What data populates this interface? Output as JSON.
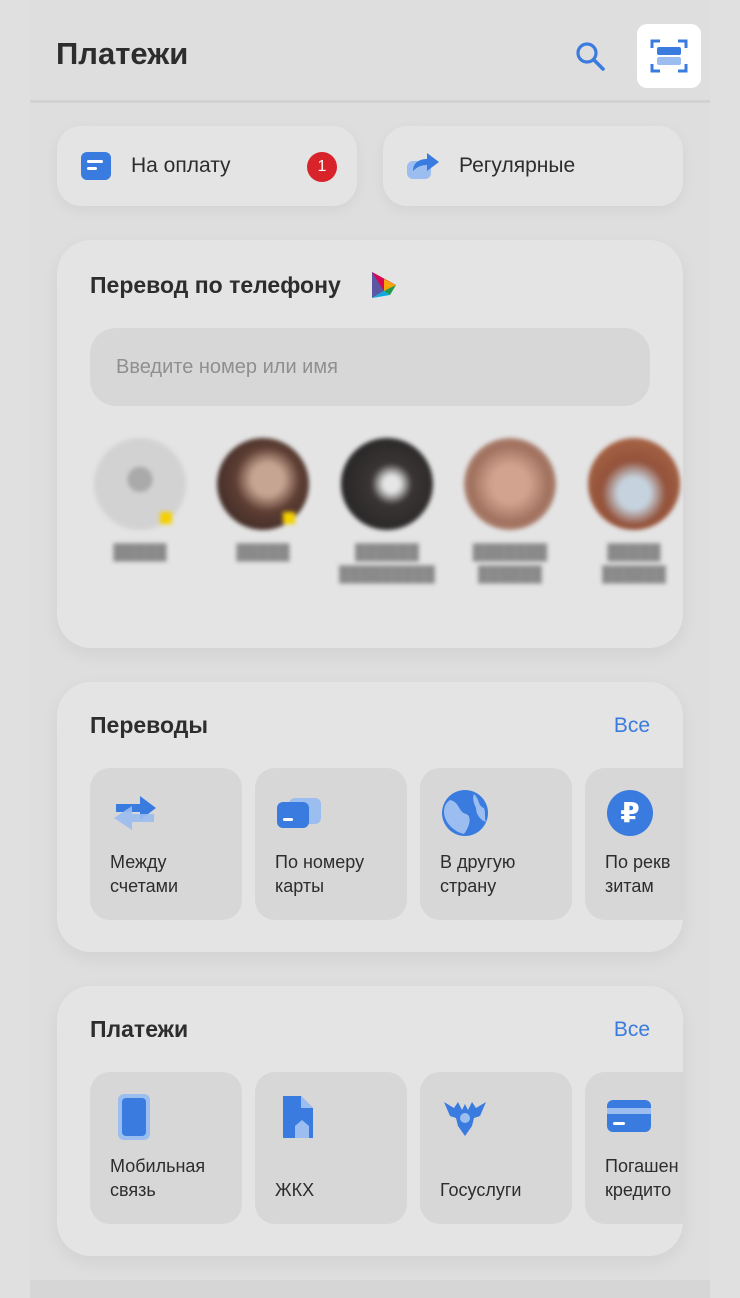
{
  "header": {
    "title": "Платежи",
    "search_icon": "search-icon",
    "scan_icon": "scan-icon",
    "accent": "#3a7be0"
  },
  "quick_actions": [
    {
      "label": "На оплату",
      "icon": "bill-icon",
      "badge": "1"
    },
    {
      "label": "Регулярные",
      "icon": "repeat-icon"
    }
  ],
  "phone_transfer": {
    "title": "Перевод по телефону",
    "sbp_icon": "sbp-logo",
    "search_placeholder": "Введите номер или имя",
    "contacts": [
      {
        "avatar_color": "#c9c9c9"
      },
      {
        "avatar_color": "#7b5a4a"
      },
      {
        "avatar_color": "#3c3434"
      },
      {
        "avatar_color": "#b88e7c"
      },
      {
        "avatar_color": "#a15c3a"
      }
    ]
  },
  "transfers": {
    "title": "Переводы",
    "all_label": "Все",
    "items": [
      {
        "label": "Между\nсчетами",
        "icon": "arrows-swap-icon"
      },
      {
        "label": "По номеру\nкарты",
        "icon": "card-icon"
      },
      {
        "label": "В другую\nстрану",
        "icon": "globe-icon"
      },
      {
        "label": "По рекв\nзитам",
        "icon": "ruble-icon"
      }
    ]
  },
  "payments": {
    "title": "Платежи",
    "all_label": "Все",
    "items": [
      {
        "label": "Мобильная\nсвязь",
        "icon": "phone-icon"
      },
      {
        "label": "ЖКХ",
        "icon": "house-icon"
      },
      {
        "label": "Госуслуги",
        "icon": "eagle-icon"
      },
      {
        "label": "Погашен\nкредито",
        "icon": "credit-card-icon"
      }
    ]
  }
}
